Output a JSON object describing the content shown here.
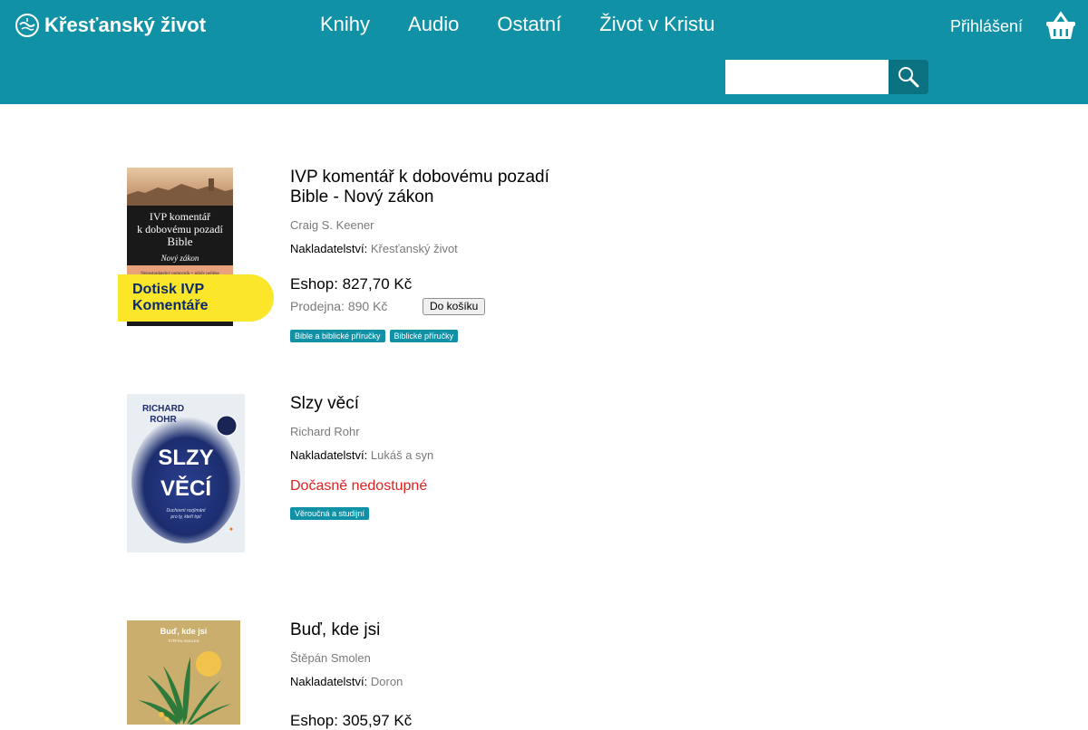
{
  "header": {
    "site_name": "Křesťanský život",
    "nav": [
      "Knihy",
      "Audio",
      "Ostatní",
      "Život v Kristu"
    ],
    "login": "Přihlášení",
    "search": {
      "value": "",
      "placeholder": ""
    },
    "colors": {
      "header_bg": "#1191a6",
      "search_button": "#0b7282",
      "tag_bg": "#1191a6",
      "ribbon_bg": "#fbe62a",
      "unavailable": "#e02020"
    }
  },
  "products": [
    {
      "title": "IVP komentář k dobovému pozadí Bible - Nový zákon",
      "author": "Craig S. Keener",
      "publisher_label": "Nakladatelství:",
      "publisher": "Křesťanský život",
      "eshop_price": "Eshop: 827,70 Kč",
      "store_price": "Prodejna: 890 Kč",
      "cart_button": "Do košíku",
      "tags": [
        "Bible a biblické příručky",
        "Biblické příručky"
      ],
      "ribbon": "Dotisk IVP Komentáře",
      "cover": {
        "line1": "IVP komentář",
        "line2": "k dobovému pozadí",
        "line3": "Bible",
        "subtitle": "Nový zákon",
        "tagline": "Nepostradatelný pomocník + nikdy nejlépe"
      }
    },
    {
      "title": "Slzy věcí",
      "author": "Richard Rohr",
      "publisher_label": "Nakladatelství:",
      "publisher": "Lukáš a syn",
      "status": "Dočasně nedostupné",
      "tags": [
        "Věroučná a studijní"
      ],
      "cover": {
        "author_top": "RICHARD",
        "author_bottom": "ROHR",
        "title_top": "SLZY",
        "title_bottom": "VĚCÍ",
        "subtitle_1": "Duchovní rozjímání",
        "subtitle_2": "pro ty, kteří trpí"
      }
    },
    {
      "title": "Buď, kde jsi",
      "author": "Štěpán Smolen",
      "publisher_label": "Nakladatelství:",
      "publisher": "Doron",
      "eshop_price": "Eshop: 305,97 Kč",
      "cover": {
        "title": "Buď, kde jsi",
        "author": "ŠTĚPÁN SMOLEN"
      }
    }
  ]
}
